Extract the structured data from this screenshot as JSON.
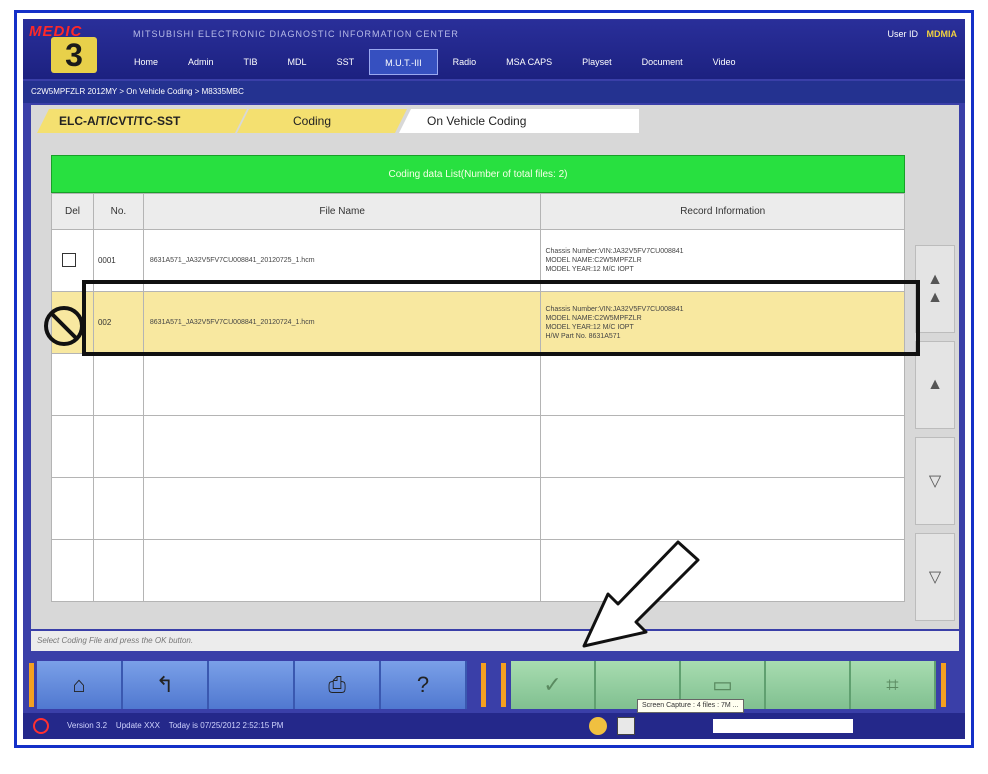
{
  "window": {
    "logo_text": "MEDIC",
    "logo_number": "3",
    "app_title": "MITSUBISHI ELECTRONIC DIAGNOSTIC INFORMATION CENTER",
    "user_label": "User ID",
    "user_value": "MDMIA"
  },
  "nav": {
    "items": [
      "Home",
      "Admin",
      "TIB",
      "MDL",
      "SST",
      "M.U.T.-III",
      "Radio",
      "MSA CAPS",
      "Playset",
      "Document",
      "Video"
    ],
    "active_index": 5
  },
  "breadcrumb": "C2W5MPFZLR 2012MY > On Vehicle Coding > M8335MBC",
  "tabs": [
    "ELC-A/T/CVT/TC-SST",
    "Coding",
    "On Vehicle Coding"
  ],
  "list_header": "Coding data List(Number of total files: 2)",
  "table": {
    "columns": [
      "Del",
      "No.",
      "File Name",
      "Record Information"
    ],
    "rows": [
      {
        "no": "0001",
        "file": "8631A571_JA32V5FV7CU008841_20120725_1.hcm",
        "record": [
          "Chassis Number:VIN:JA32V5FV7CU008841",
          "MODEL NAME:C2W5MPFZLR",
          "MODEL YEAR:12 M/C IOPT"
        ]
      },
      {
        "no": "002",
        "file": "8631A571_JA32V5FV7CU008841_20120724_1.hcm",
        "record": [
          "Chassis Number:VIN:JA32V5FV7CU008841",
          "MODEL NAME:C2W5MPFZLR",
          "MODEL YEAR:12 M/C IOPT",
          "H/W Part No. 8631A571"
        ]
      }
    ],
    "selected_index": 1
  },
  "instruction": "Select Coding File and press the OK button.",
  "tooltip": "Screen Capture : 4 files : 7M ...",
  "status": {
    "version": "Version 3.2",
    "update": "Update XXX",
    "today": "Today is 07/25/2012 2:52:15 PM"
  },
  "colors": {
    "frame": "#1430c8",
    "header_bar": "#28e040",
    "selected_row": "#f8e8a0",
    "tab_active": "#f4e070"
  }
}
